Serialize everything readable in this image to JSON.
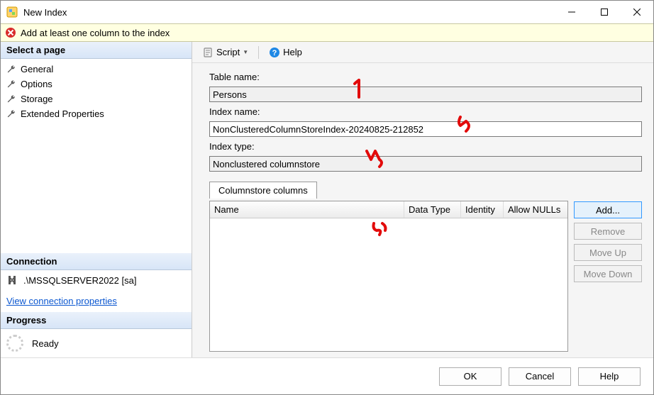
{
  "titlebar": {
    "title": "New Index"
  },
  "warning": {
    "text": "Add at least one column to the index"
  },
  "sidebar": {
    "select_page_header": "Select a page",
    "pages": [
      {
        "label": "General"
      },
      {
        "label": "Options"
      },
      {
        "label": "Storage"
      },
      {
        "label": "Extended Properties"
      }
    ],
    "connection_header": "Connection",
    "connection_value": ".\\MSSQLSERVER2022 [sa]",
    "view_conn_link": "View connection properties",
    "progress_header": "Progress",
    "progress_status": "Ready"
  },
  "toolbar": {
    "script": "Script",
    "help": "Help"
  },
  "form": {
    "table_name_label": "Table name:",
    "table_name_value": "Persons",
    "index_name_label": "Index name:",
    "index_name_value": "NonClusteredColumnStoreIndex-20240825-212852",
    "index_type_label": "Index type:",
    "index_type_value": "Nonclustered columnstore",
    "tab_label": "Columnstore columns",
    "col_name": "Name",
    "col_data_type": "Data Type",
    "col_identity": "Identity",
    "col_allow_nulls": "Allow NULLs",
    "btn_add": "Add...",
    "btn_remove": "Remove",
    "btn_move_up": "Move Up",
    "btn_move_down": "Move Down"
  },
  "dialog": {
    "ok": "OK",
    "cancel": "Cancel",
    "help": "Help"
  }
}
